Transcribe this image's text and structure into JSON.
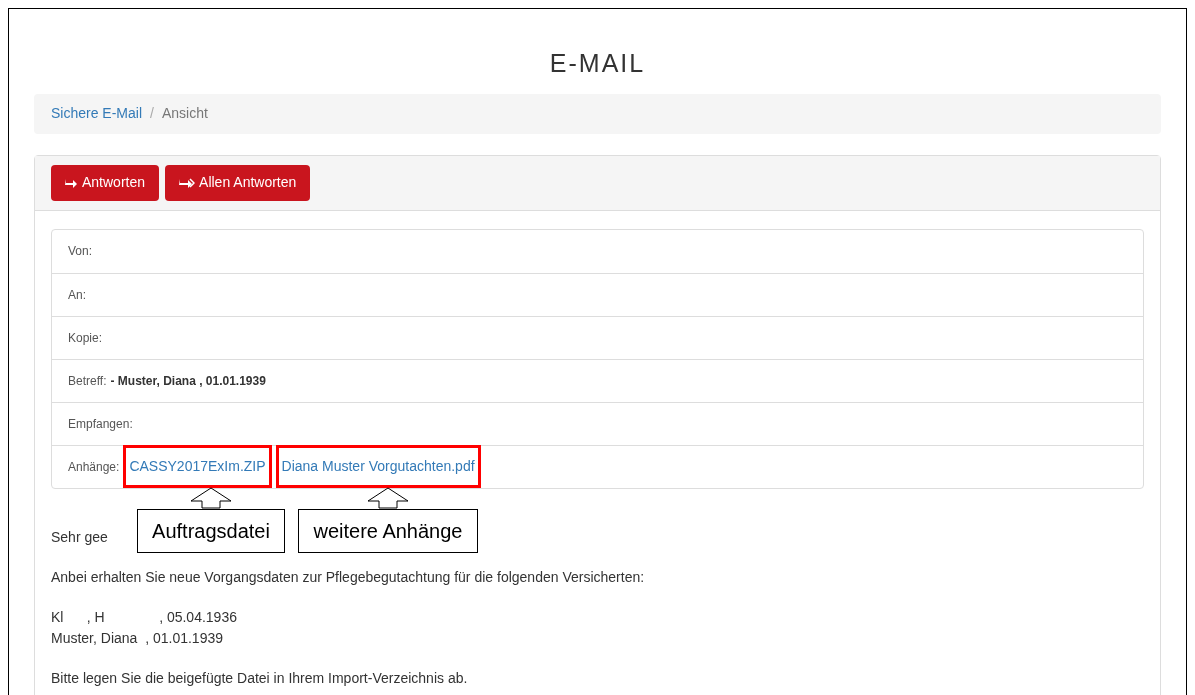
{
  "page_title": "E-MAIL",
  "breadcrumb_separator": "/",
  "breadcrumb": [
    {
      "label": "Sichere E-Mail",
      "kind": "link"
    },
    {
      "label": "Ansicht",
      "kind": "current"
    }
  ],
  "toolbar": [
    {
      "label": "Antworten",
      "kind": "reply"
    },
    {
      "label": "Allen Antworten",
      "kind": "reply_all"
    }
  ],
  "header_fields": [
    {
      "label": "Von:"
    },
    {
      "label": "An:"
    },
    {
      "label": "Kopie:"
    },
    {
      "label": "Betreff:",
      "value": "- Muster, Diana , 01.01.1939"
    },
    {
      "label": "Empfangen:"
    },
    {
      "label": "Anhänge:",
      "attachments": [
        "CASSY2017ExIm.ZIP",
        "Diana Muster Vorgutachten.pdf"
      ]
    }
  ],
  "callouts": [
    "Auftragsdatei",
    "weitere Anhänge"
  ],
  "body": [
    {
      "text": "Sehr gee"
    },
    {
      "text": "Anbei erhalten Sie neue Vorgangsdaten zur Pflegebegutachtung für die folgenden Versicherten:"
    },
    {
      "lines": [
        "Kl      , H              , 05.04.1936",
        "Muster, Diana  , 01.01.1939"
      ]
    },
    {
      "text": "Bitte legen Sie die beigefügte Datei in Ihrem Import-Verzeichnis ab."
    }
  ]
}
